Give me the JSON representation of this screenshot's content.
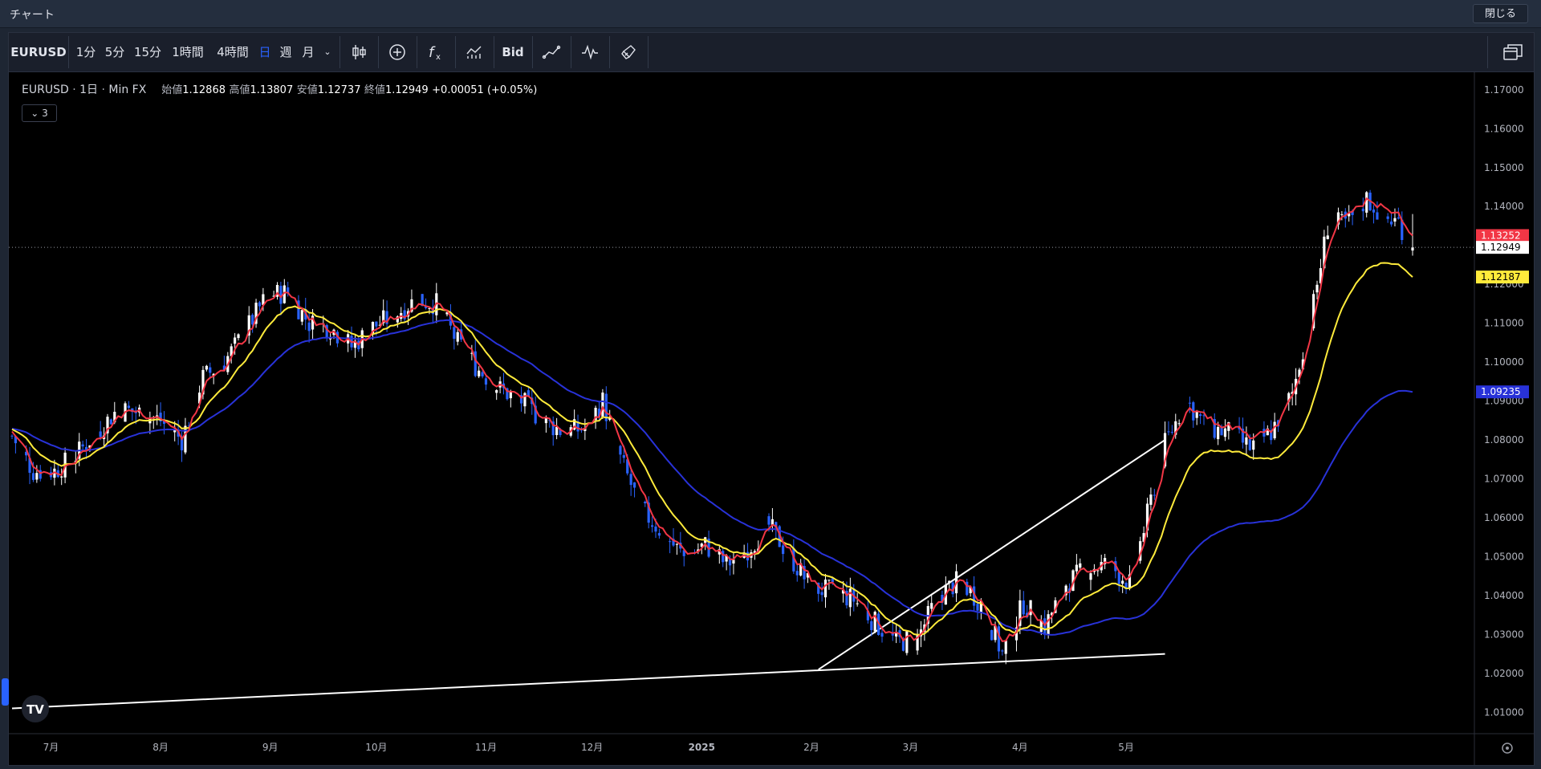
{
  "window": {
    "title": "チャート",
    "close_label": "閉じる"
  },
  "toolbar": {
    "symbol": "EURUSD",
    "intervals": [
      "1分",
      "5分",
      "15分",
      "1時間",
      "4時間",
      "日",
      "週",
      "月"
    ],
    "active_interval": "日",
    "price_type": "Bid",
    "icons": [
      "candles-icon",
      "add-indicator-icon",
      "function-icon",
      "compare-icon",
      "bid-toggle",
      "line-tool-icon",
      "wave-tool-icon",
      "brush-icon",
      "layout-icon"
    ]
  },
  "legend": {
    "symbol": "EURUSD",
    "interval": "1日",
    "source": "Min FX",
    "open_label": "始値",
    "open": "1.12868",
    "high_label": "高値",
    "high": "1.13807",
    "low_label": "安値",
    "low": "1.12737",
    "close_label": "終値",
    "close": "1.12949",
    "change": "+0.00051 (+0.05%)",
    "indicators_count": "3"
  },
  "colors": {
    "up": "#ffffff",
    "down": "#2962ff",
    "ma_short": "#f23645",
    "ma_mid": "#ffeb3b",
    "ma_long": "#2832d8",
    "trendline": "#ffffff",
    "background": "#000000"
  },
  "chart_data": {
    "type": "candlestick",
    "symbol": "EURUSD",
    "period": "2024-06 to 2025-05 daily",
    "y_axis_ticks": [
      "1.17000",
      "1.16000",
      "1.15000",
      "1.14000",
      "1.13000",
      "1.12000",
      "1.11000",
      "1.10000",
      "1.09000",
      "1.08000",
      "1.07000",
      "1.06000",
      "1.05000",
      "1.04000",
      "1.03000",
      "1.02000",
      "1.01000"
    ],
    "ylim": [
      1.0045,
      1.1745
    ],
    "x_axis_labels": [
      "7月",
      "8月",
      "9月",
      "10月",
      "11月",
      "12月",
      "2025",
      "2月",
      "3月",
      "4月",
      "5月"
    ],
    "price_labels": [
      {
        "value": "1.13252",
        "color": "#f23645"
      },
      {
        "value": "1.12949",
        "color": "#ffffff"
      },
      {
        "value": "1.12187",
        "color": "#ffeb3b"
      },
      {
        "value": "1.09235",
        "color": "#2832d8"
      }
    ],
    "current_price": 1.12949,
    "moving_averages": [
      {
        "color": "#f23645",
        "last": 1.13252
      },
      {
        "color": "#ffeb3b",
        "last": 1.12187
      },
      {
        "color": "#2832d8",
        "last": 1.09235
      }
    ],
    "trendlines": [
      {
        "from": [
          "2024-06-20",
          1.011
        ],
        "to": [
          "2025-05-12",
          1.025
        ]
      },
      {
        "from": [
          "2025-02-03",
          1.021
        ],
        "to": [
          "2025-05-12",
          1.08
        ]
      }
    ],
    "anchors": [
      [
        0,
        1.081
      ],
      [
        6,
        1.072
      ],
      [
        12,
        1.072
      ],
      [
        18,
        1.076
      ],
      [
        24,
        1.082
      ],
      [
        30,
        1.088
      ],
      [
        36,
        1.087
      ],
      [
        42,
        1.085
      ],
      [
        48,
        1.08
      ],
      [
        54,
        1.096
      ],
      [
        60,
        1.1
      ],
      [
        66,
        1.108
      ],
      [
        72,
        1.117
      ],
      [
        78,
        1.118
      ],
      [
        84,
        1.11
      ],
      [
        90,
        1.109
      ],
      [
        96,
        1.104
      ],
      [
        102,
        1.109
      ],
      [
        108,
        1.112
      ],
      [
        114,
        1.116
      ],
      [
        120,
        1.115
      ],
      [
        126,
        1.105
      ],
      [
        132,
        1.098
      ],
      [
        138,
        1.093
      ],
      [
        144,
        1.09
      ],
      [
        150,
        1.085
      ],
      [
        156,
        1.082
      ],
      [
        162,
        1.083
      ],
      [
        167,
        1.09
      ],
      [
        172,
        1.075
      ],
      [
        178,
        1.062
      ],
      [
        184,
        1.056
      ],
      [
        190,
        1.05
      ],
      [
        196,
        1.053
      ],
      [
        202,
        1.048
      ],
      [
        208,
        1.052
      ],
      [
        214,
        1.058
      ],
      [
        220,
        1.05
      ],
      [
        226,
        1.042
      ],
      [
        232,
        1.041
      ],
      [
        238,
        1.039
      ],
      [
        244,
        1.033
      ],
      [
        250,
        1.028
      ],
      [
        256,
        1.029
      ],
      [
        262,
        1.04
      ],
      [
        268,
        1.044
      ],
      [
        274,
        1.038
      ],
      [
        280,
        1.025
      ],
      [
        286,
        1.038
      ],
      [
        292,
        1.032
      ],
      [
        298,
        1.043
      ],
      [
        304,
        1.047
      ],
      [
        310,
        1.048
      ],
      [
        316,
        1.043
      ],
      [
        320,
        1.057
      ],
      [
        326,
        1.079
      ],
      [
        332,
        1.09
      ],
      [
        338,
        1.083
      ],
      [
        344,
        1.082
      ],
      [
        350,
        1.078
      ],
      [
        356,
        1.082
      ],
      [
        362,
        1.092
      ],
      [
        368,
        1.115
      ],
      [
        372,
        1.135
      ],
      [
        378,
        1.136
      ],
      [
        383,
        1.142
      ],
      [
        388,
        1.137
      ],
      [
        392,
        1.136
      ],
      [
        396,
        1.1295
      ]
    ]
  }
}
